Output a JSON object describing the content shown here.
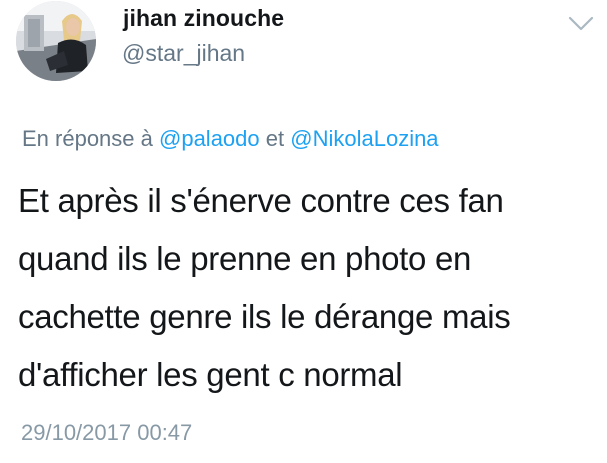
{
  "user": {
    "display_name": "jihan zinouche",
    "handle": "@star_jihan"
  },
  "reply": {
    "prefix": "En réponse à",
    "mention_1": "@palaodo",
    "joiner": "et",
    "mention_2": "@NikolaLozina"
  },
  "tweet": {
    "lines": [
      "Et après il s'énerve contre ces fan",
      "quand ils le prenne en photo en",
      "cachette genre ils le dérange mais",
      "d'afficher les gent c normal"
    ],
    "timestamp": "29/10/2017 00:47"
  },
  "icons": {
    "menu": "chevron-down-icon"
  },
  "colors": {
    "link": "#1da1f2",
    "secondary_text": "#657786",
    "timestamp": "#8899a6",
    "chevron": "#aab8c2"
  }
}
